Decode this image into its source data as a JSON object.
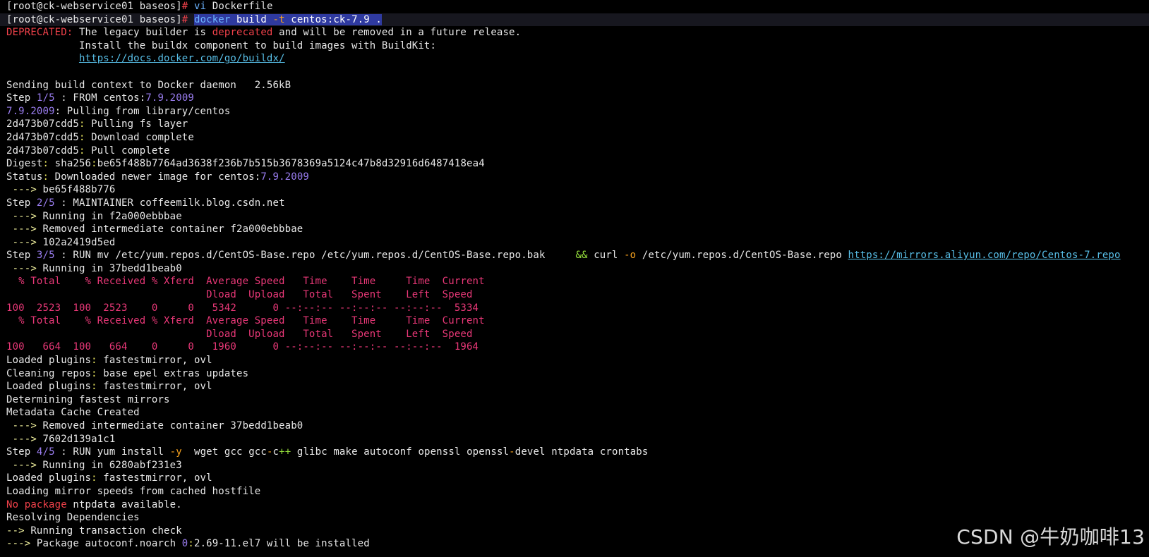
{
  "terminal": {
    "lines": [
      {
        "cls": "",
        "segs": [
          [
            "c-white",
            "[root@ck-webservice01 baseos]"
          ],
          [
            "c-red",
            "#"
          ],
          [
            "c-white",
            " "
          ],
          [
            "c-blue",
            "vi"
          ],
          [
            "c-white",
            " Dockerfile"
          ]
        ]
      },
      {
        "cls": "cmdline",
        "segs": [
          [
            "c-white",
            "[root@ck-webservice01 baseos]"
          ],
          [
            "c-red",
            "#"
          ],
          [
            "c-white",
            " "
          ],
          [
            "sel c-blue",
            "docker"
          ],
          [
            "sel",
            " build "
          ],
          [
            "sel c-orange",
            "-t"
          ],
          [
            "sel",
            " centos:ck-7.9 ."
          ]
        ]
      },
      {
        "cls": "",
        "segs": [
          [
            "c-red",
            "DEPRECATED:"
          ],
          [
            "c-white",
            " The legacy builder is "
          ],
          [
            "c-red",
            "deprecated"
          ],
          [
            "c-white",
            " and will be removed in a future release."
          ]
        ]
      },
      {
        "cls": "",
        "segs": [
          [
            "c-white",
            "            Install the buildx component to build images with BuildKit:"
          ]
        ]
      },
      {
        "cls": "",
        "segs": [
          [
            "c-white",
            "            "
          ],
          [
            "c-link",
            "https://docs.docker.com/go/buildx/"
          ]
        ]
      },
      {
        "cls": "",
        "segs": [
          [
            "c-white",
            ""
          ]
        ]
      },
      {
        "cls": "",
        "segs": [
          [
            "c-white",
            "Sending build context to Docker daemon   2.56kB"
          ]
        ]
      },
      {
        "cls": "",
        "segs": [
          [
            "c-white",
            "Step "
          ],
          [
            "c-purple",
            "1/5"
          ],
          [
            "c-white",
            " : FROM centos:"
          ],
          [
            "c-purple",
            "7.9.2009"
          ]
        ]
      },
      {
        "cls": "",
        "segs": [
          [
            "c-purple",
            "7.9.2009"
          ],
          [
            "c-white",
            ": Pulling from library/centos"
          ]
        ]
      },
      {
        "cls": "",
        "segs": [
          [
            "c-white",
            "2d473b07cdd5"
          ],
          [
            "c-yellow",
            ":"
          ],
          [
            "c-white",
            " Pulling fs layer"
          ]
        ]
      },
      {
        "cls": "",
        "segs": [
          [
            "c-white",
            "2d473b07cdd5"
          ],
          [
            "c-yellow",
            ":"
          ],
          [
            "c-white",
            " Download complete"
          ]
        ]
      },
      {
        "cls": "",
        "segs": [
          [
            "c-white",
            "2d473b07cdd5"
          ],
          [
            "c-yellow",
            ":"
          ],
          [
            "c-white",
            " Pull complete"
          ]
        ]
      },
      {
        "cls": "",
        "segs": [
          [
            "c-white",
            "Digest"
          ],
          [
            "c-yellow",
            ":"
          ],
          [
            "c-white",
            " sha256"
          ],
          [
            "c-yellow",
            ":"
          ],
          [
            "c-white",
            "be65f488b7764ad3638f236b7b515b3678369a5124c47b8d32916d6487418ea4"
          ]
        ]
      },
      {
        "cls": "",
        "segs": [
          [
            "c-white",
            "Status"
          ],
          [
            "c-yellow",
            ":"
          ],
          [
            "c-white",
            " Downloaded newer image for centos:"
          ],
          [
            "c-purple",
            "7.9.2009"
          ]
        ]
      },
      {
        "cls": "",
        "segs": [
          [
            "c-tealarrow",
            " --->"
          ],
          [
            "c-white",
            " be65f488b776"
          ]
        ]
      },
      {
        "cls": "",
        "segs": [
          [
            "c-white",
            "Step "
          ],
          [
            "c-purple",
            "2/5"
          ],
          [
            "c-white",
            " : MAINTAINER coffeemilk.blog.csdn.net"
          ]
        ]
      },
      {
        "cls": "",
        "segs": [
          [
            "c-tealarrow",
            " --->"
          ],
          [
            "c-white",
            " Running in f2a000ebbbae"
          ]
        ]
      },
      {
        "cls": "",
        "segs": [
          [
            "c-tealarrow",
            " --->"
          ],
          [
            "c-white",
            " Removed intermediate container f2a000ebbbae"
          ]
        ]
      },
      {
        "cls": "",
        "segs": [
          [
            "c-tealarrow",
            " --->"
          ],
          [
            "c-white",
            " 102a2419d5ed"
          ]
        ]
      },
      {
        "cls": "",
        "segs": [
          [
            "c-white",
            "Step "
          ],
          [
            "c-purple",
            "3/5"
          ],
          [
            "c-white",
            " : RUN mv /etc/yum.repos.d/CentOS-Base.repo /etc/yum.repos.d/CentOS-Base.repo.bak     "
          ],
          [
            "c-green",
            "&&"
          ],
          [
            "c-white",
            " curl "
          ],
          [
            "c-orange",
            "-o"
          ],
          [
            "c-white",
            " /etc/yum.repos.d/CentOS-Base.repo "
          ],
          [
            "c-link",
            "https://mirrors.aliyun.com/repo/Centos-7.repo"
          ]
        ]
      },
      {
        "cls": "",
        "segs": [
          [
            "c-tealarrow",
            " --->"
          ],
          [
            "c-white",
            " Running in 37bedd1beab0"
          ]
        ]
      },
      {
        "cls": "",
        "segs": [
          [
            "c-pink",
            "  % Total    % Received % Xferd  Average Speed   Time    Time     Time  Current"
          ]
        ]
      },
      {
        "cls": "",
        "segs": [
          [
            "c-pink",
            "                                 Dload  Upload   Total   Spent    Left  Speed"
          ]
        ]
      },
      {
        "cls": "",
        "segs": [
          [
            "c-pink",
            "100  2523  100  2523    0     0   5342      0 --:--:-- --:--:-- --:--:--  5334"
          ]
        ]
      },
      {
        "cls": "",
        "segs": [
          [
            "c-pink",
            "  % Total    % Received % Xferd  Average Speed   Time    Time     Time  Current"
          ]
        ]
      },
      {
        "cls": "",
        "segs": [
          [
            "c-pink",
            "                                 Dload  Upload   Total   Spent    Left  Speed"
          ]
        ]
      },
      {
        "cls": "",
        "segs": [
          [
            "c-pink",
            "100   664  100   664    0     0   1960      0 --:--:-- --:--:-- --:--:--  1964"
          ]
        ]
      },
      {
        "cls": "",
        "segs": [
          [
            "c-white",
            "Loaded plugins"
          ],
          [
            "c-yellow",
            ":"
          ],
          [
            "c-white",
            " fastestmirror, ovl"
          ]
        ]
      },
      {
        "cls": "",
        "segs": [
          [
            "c-white",
            "Cleaning repos"
          ],
          [
            "c-yellow",
            ":"
          ],
          [
            "c-white",
            " base epel extras updates"
          ]
        ]
      },
      {
        "cls": "",
        "segs": [
          [
            "c-white",
            "Loaded plugins"
          ],
          [
            "c-yellow",
            ":"
          ],
          [
            "c-white",
            " fastestmirror, ovl"
          ]
        ]
      },
      {
        "cls": "",
        "segs": [
          [
            "c-white",
            "Determining fastest mirrors"
          ]
        ]
      },
      {
        "cls": "",
        "segs": [
          [
            "c-white",
            "Metadata Cache Created"
          ]
        ]
      },
      {
        "cls": "",
        "segs": [
          [
            "c-tealarrow",
            " --->"
          ],
          [
            "c-white",
            " Removed intermediate container 37bedd1beab0"
          ]
        ]
      },
      {
        "cls": "",
        "segs": [
          [
            "c-tealarrow",
            " --->"
          ],
          [
            "c-white",
            " 7602d139a1c1"
          ]
        ]
      },
      {
        "cls": "",
        "segs": [
          [
            "c-white",
            "Step "
          ],
          [
            "c-purple",
            "4/5"
          ],
          [
            "c-white",
            " : RUN yum install "
          ],
          [
            "c-orange",
            "-y"
          ],
          [
            "c-white",
            "  wget gcc gcc"
          ],
          [
            "c-orange",
            "-"
          ],
          [
            "c-white",
            "c"
          ],
          [
            "c-green",
            "++"
          ],
          [
            "c-white",
            " glibc make autoconf openssl openssl"
          ],
          [
            "c-orange",
            "-"
          ],
          [
            "c-white",
            "devel ntpdata crontabs"
          ]
        ]
      },
      {
        "cls": "",
        "segs": [
          [
            "c-tealarrow",
            " --->"
          ],
          [
            "c-white",
            " Running in 6280abf231e3"
          ]
        ]
      },
      {
        "cls": "",
        "segs": [
          [
            "c-white",
            "Loaded plugins"
          ],
          [
            "c-yellow",
            ":"
          ],
          [
            "c-white",
            " fastestmirror, ovl"
          ]
        ]
      },
      {
        "cls": "",
        "segs": [
          [
            "c-white",
            "Loading mirror speeds from cached hostfile"
          ]
        ]
      },
      {
        "cls": "",
        "segs": [
          [
            "c-red",
            "No package"
          ],
          [
            "c-white",
            " ntpdata available."
          ]
        ]
      },
      {
        "cls": "",
        "segs": [
          [
            "c-white",
            "Resolving Dependencies"
          ]
        ]
      },
      {
        "cls": "",
        "segs": [
          [
            "c-tealarrow",
            "-->"
          ],
          [
            "c-white",
            " Running transaction check"
          ]
        ]
      },
      {
        "cls": "",
        "segs": [
          [
            "c-tealarrow",
            "--->"
          ],
          [
            "c-white",
            " Package autoconf.noarch "
          ],
          [
            "c-purple",
            "0"
          ],
          [
            "c-yellow",
            ":"
          ],
          [
            "c-white",
            "2.69-11.el7 will be installed"
          ]
        ]
      }
    ]
  },
  "watermark": {
    "text": "CSDN @牛奶咖啡13"
  }
}
